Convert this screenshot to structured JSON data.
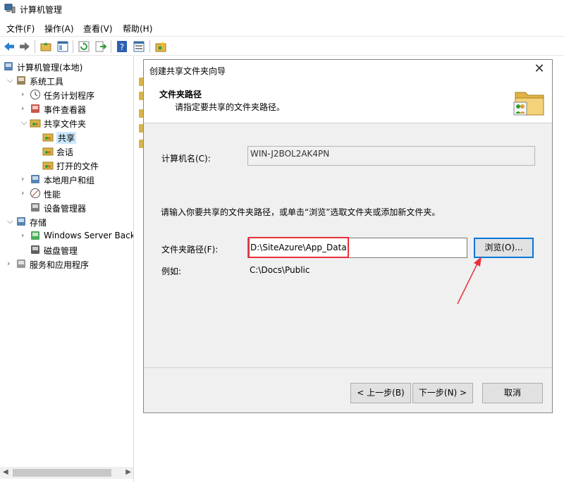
{
  "window": {
    "title": "计算机管理",
    "icon": "computer-management-icon"
  },
  "menu": [
    "文件(F)",
    "操作(A)",
    "查看(V)",
    "帮助(H)"
  ],
  "toolbar": {
    "icons": [
      "back-icon",
      "forward-icon",
      "up-folder-icon",
      "show-hide-tree-icon",
      "refresh-icon",
      "export-list-icon",
      "help-icon",
      "properties-icon",
      "new-share-icon"
    ]
  },
  "tree": {
    "items": [
      {
        "label": "计算机管理(本地)",
        "level": 0,
        "icon": "computer-management-icon",
        "chevron": ""
      },
      {
        "label": "系统工具",
        "level": 1,
        "icon": "system-tools-icon",
        "chevron": "v"
      },
      {
        "label": "任务计划程序",
        "level": 2,
        "icon": "clock-icon",
        "chevron": ">"
      },
      {
        "label": "事件查看器",
        "level": 2,
        "icon": "event-viewer-icon",
        "chevron": ">"
      },
      {
        "label": "共享文件夹",
        "level": 2,
        "icon": "shared-folder-icon",
        "chevron": "v"
      },
      {
        "label": "共享",
        "level": 3,
        "icon": "share-icon",
        "chevron": "",
        "selected": true
      },
      {
        "label": "会话",
        "level": 3,
        "icon": "sessions-icon",
        "chevron": ""
      },
      {
        "label": "打开的文件",
        "level": 3,
        "icon": "open-files-icon",
        "chevron": ""
      },
      {
        "label": "本地用户和组",
        "level": 2,
        "icon": "users-icon",
        "chevron": ">"
      },
      {
        "label": "性能",
        "level": 2,
        "icon": "performance-icon",
        "chevron": ">"
      },
      {
        "label": "设备管理器",
        "level": 2,
        "icon": "device-manager-icon",
        "chevron": ""
      },
      {
        "label": "存储",
        "level": 1,
        "icon": "storage-icon",
        "chevron": "v"
      },
      {
        "label": "Windows Server Back",
        "level": 2,
        "icon": "backup-icon",
        "chevron": ">"
      },
      {
        "label": "磁盘管理",
        "level": 2,
        "icon": "disk-management-icon",
        "chevron": ""
      },
      {
        "label": "服务和应用程序",
        "level": 1,
        "icon": "services-icon",
        "chevron": ">"
      }
    ]
  },
  "dialog": {
    "title": "创建共享文件夹向导",
    "header_title": "文件夹路径",
    "header_subtitle": "请指定要共享的文件夹路径。",
    "computer_label": "计算机名(C):",
    "computer_value": "WIN-J2BOL2AK4PN",
    "instruction": "请输入你要共享的文件夹路径，或单击“浏览”选取文件夹或添加新文件夹。",
    "path_label": "文件夹路径(F):",
    "path_value": "D:\\SiteAzure\\App_Data",
    "browse_button": "浏览(O)...",
    "example_label": "例如:",
    "example_value": "C:\\Docs\\Public",
    "back_button": "< 上一步(B)",
    "next_button": "下一步(N) >",
    "cancel_button": "取消",
    "close_glyph": "✕"
  },
  "annotation": {
    "highlight_color": "#e8303a",
    "arrow_color": "#e8303a"
  }
}
